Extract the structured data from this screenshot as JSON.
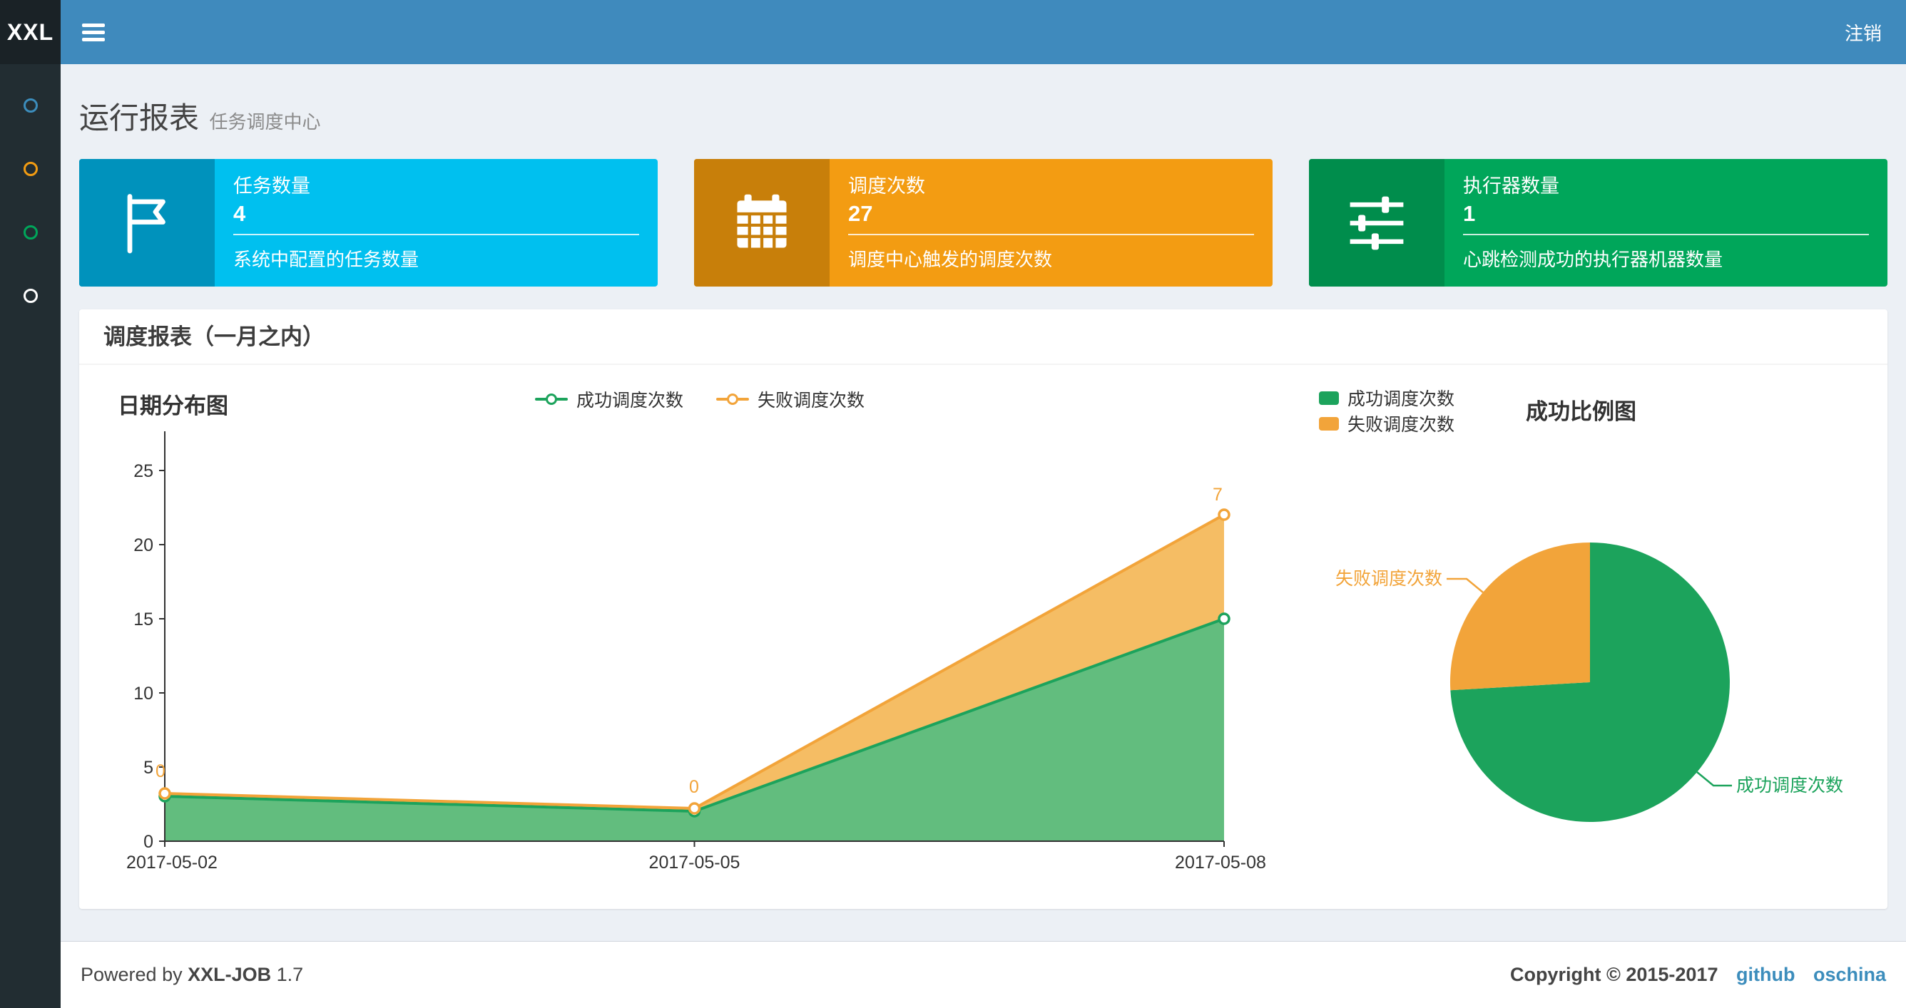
{
  "navbar": {
    "logo": "XXL",
    "logout": "注销"
  },
  "sidebar": {
    "items": [
      {
        "icon_color": "#3c8dbc"
      },
      {
        "icon_color": "#f39c12"
      },
      {
        "icon_color": "#00a65a"
      },
      {
        "icon_color": "#ffffff"
      }
    ]
  },
  "page_header": {
    "title": "运行报表",
    "subtitle": "任务调度中心"
  },
  "info_boxes": [
    {
      "title": "任务数量",
      "value": "4",
      "description": "系统中配置的任务数量",
      "bg": "#00c0ef",
      "icon_bg": "#0092bc",
      "icon": "flag-icon"
    },
    {
      "title": "调度次数",
      "value": "27",
      "description": "调度中心触发的调度次数",
      "bg": "#f39c12",
      "icon_bg": "#c87f0a",
      "icon": "calendar-icon"
    },
    {
      "title": "执行器数量",
      "value": "1",
      "description": "心跳检测成功的执行器机器数量",
      "bg": "#00a65a",
      "icon_bg": "#008d4c",
      "icon": "sliders-icon"
    }
  ],
  "panel_title": "调度报表（一月之内）",
  "chart_data": [
    {
      "type": "area",
      "title": "日期分布图",
      "stacked": true,
      "x": [
        "2017-05-02",
        "2017-05-05",
        "2017-05-08"
      ],
      "series": [
        {
          "name": "成功调度次数",
          "values": [
            3,
            2,
            15
          ],
          "color": "#1CA35C",
          "area_color": "#62BD7E"
        },
        {
          "name": "失败调度次数",
          "values": [
            0,
            0,
            7
          ],
          "stacked_totals": [
            3,
            2,
            22
          ],
          "color": "#F2A43A",
          "area_color": "#F5BD64",
          "point_labels": [
            "0",
            "0",
            "7"
          ]
        }
      ],
      "ylim": [
        0,
        25
      ],
      "yticks": [
        "0",
        "5",
        "10",
        "15",
        "20",
        "25"
      ],
      "legend_position": "top-center",
      "grid": false
    },
    {
      "type": "pie",
      "title": "成功比例图",
      "slices": [
        {
          "name": "成功调度次数",
          "value": 20,
          "percent": 74.1,
          "color": "#1CA35C"
        },
        {
          "name": "失败调度次数",
          "value": 7,
          "percent": 25.9,
          "color": "#F2A43A"
        }
      ],
      "legend_position": "top-left"
    }
  ],
  "footer": {
    "powered_by": "Powered by",
    "brand": "XXL-JOB",
    "version": "1.7",
    "copyright": "Copyright © 2015-2017",
    "links": [
      {
        "label": "github"
      },
      {
        "label": "oschina"
      }
    ]
  }
}
